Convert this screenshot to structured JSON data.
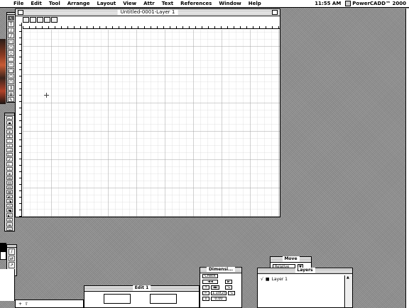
{
  "menubar": {
    "apple": "",
    "items": [
      "File",
      "Edit",
      "Tool",
      "Arrange",
      "Layout",
      "View",
      "Attr",
      "Text",
      "References",
      "Window",
      "Help"
    ],
    "clock": "11:55 AM",
    "app_name": "PowerCADD™ 2000"
  },
  "document": {
    "title": "Untitled-0001-Layer 1"
  },
  "panels": {
    "move": {
      "title": "Move",
      "field_value": "Relative",
      "button": "▼"
    },
    "dimensions": {
      "title": "Dimensi...",
      "rows": [
        [
          "Check"
        ],
        [
          "◄◄",
          "►"
        ],
        [
          "↑",
          "◄►",
          "↘"
        ],
        [
          "⇐",
          "1.10(2)",
          "↘"
        ],
        [
          "⇓",
          "0.00"
        ]
      ]
    },
    "layers": {
      "title": "Layers",
      "layer_check": "√",
      "layer_name": "Layer 1"
    },
    "edit": {
      "title": "Edit 1"
    }
  },
  "bottom_strip": {
    "plus": "+"
  },
  "tools": {
    "palette1": [
      "↖",
      "T",
      "/",
      "╱",
      "□",
      "○",
      "◇",
      "⌒",
      "◠",
      "◯",
      "⬠",
      "⬡",
      "⇕",
      "⊕",
      "✎"
    ],
    "palette2": [
      "▸",
      "▪",
      "⌐",
      "+",
      "┼",
      "·",
      "⊥",
      "⊣",
      "⊢",
      "∠",
      "∟",
      "⟂",
      "⌖",
      "⊞",
      "⊟",
      "⊡",
      "⊠",
      "◐",
      "◑",
      "◒",
      "⬔",
      "⬕",
      "⊘",
      "≡",
      "⇲"
    ],
    "palette3": [
      "/",
      "⇄",
      "↗",
      "●"
    ]
  }
}
